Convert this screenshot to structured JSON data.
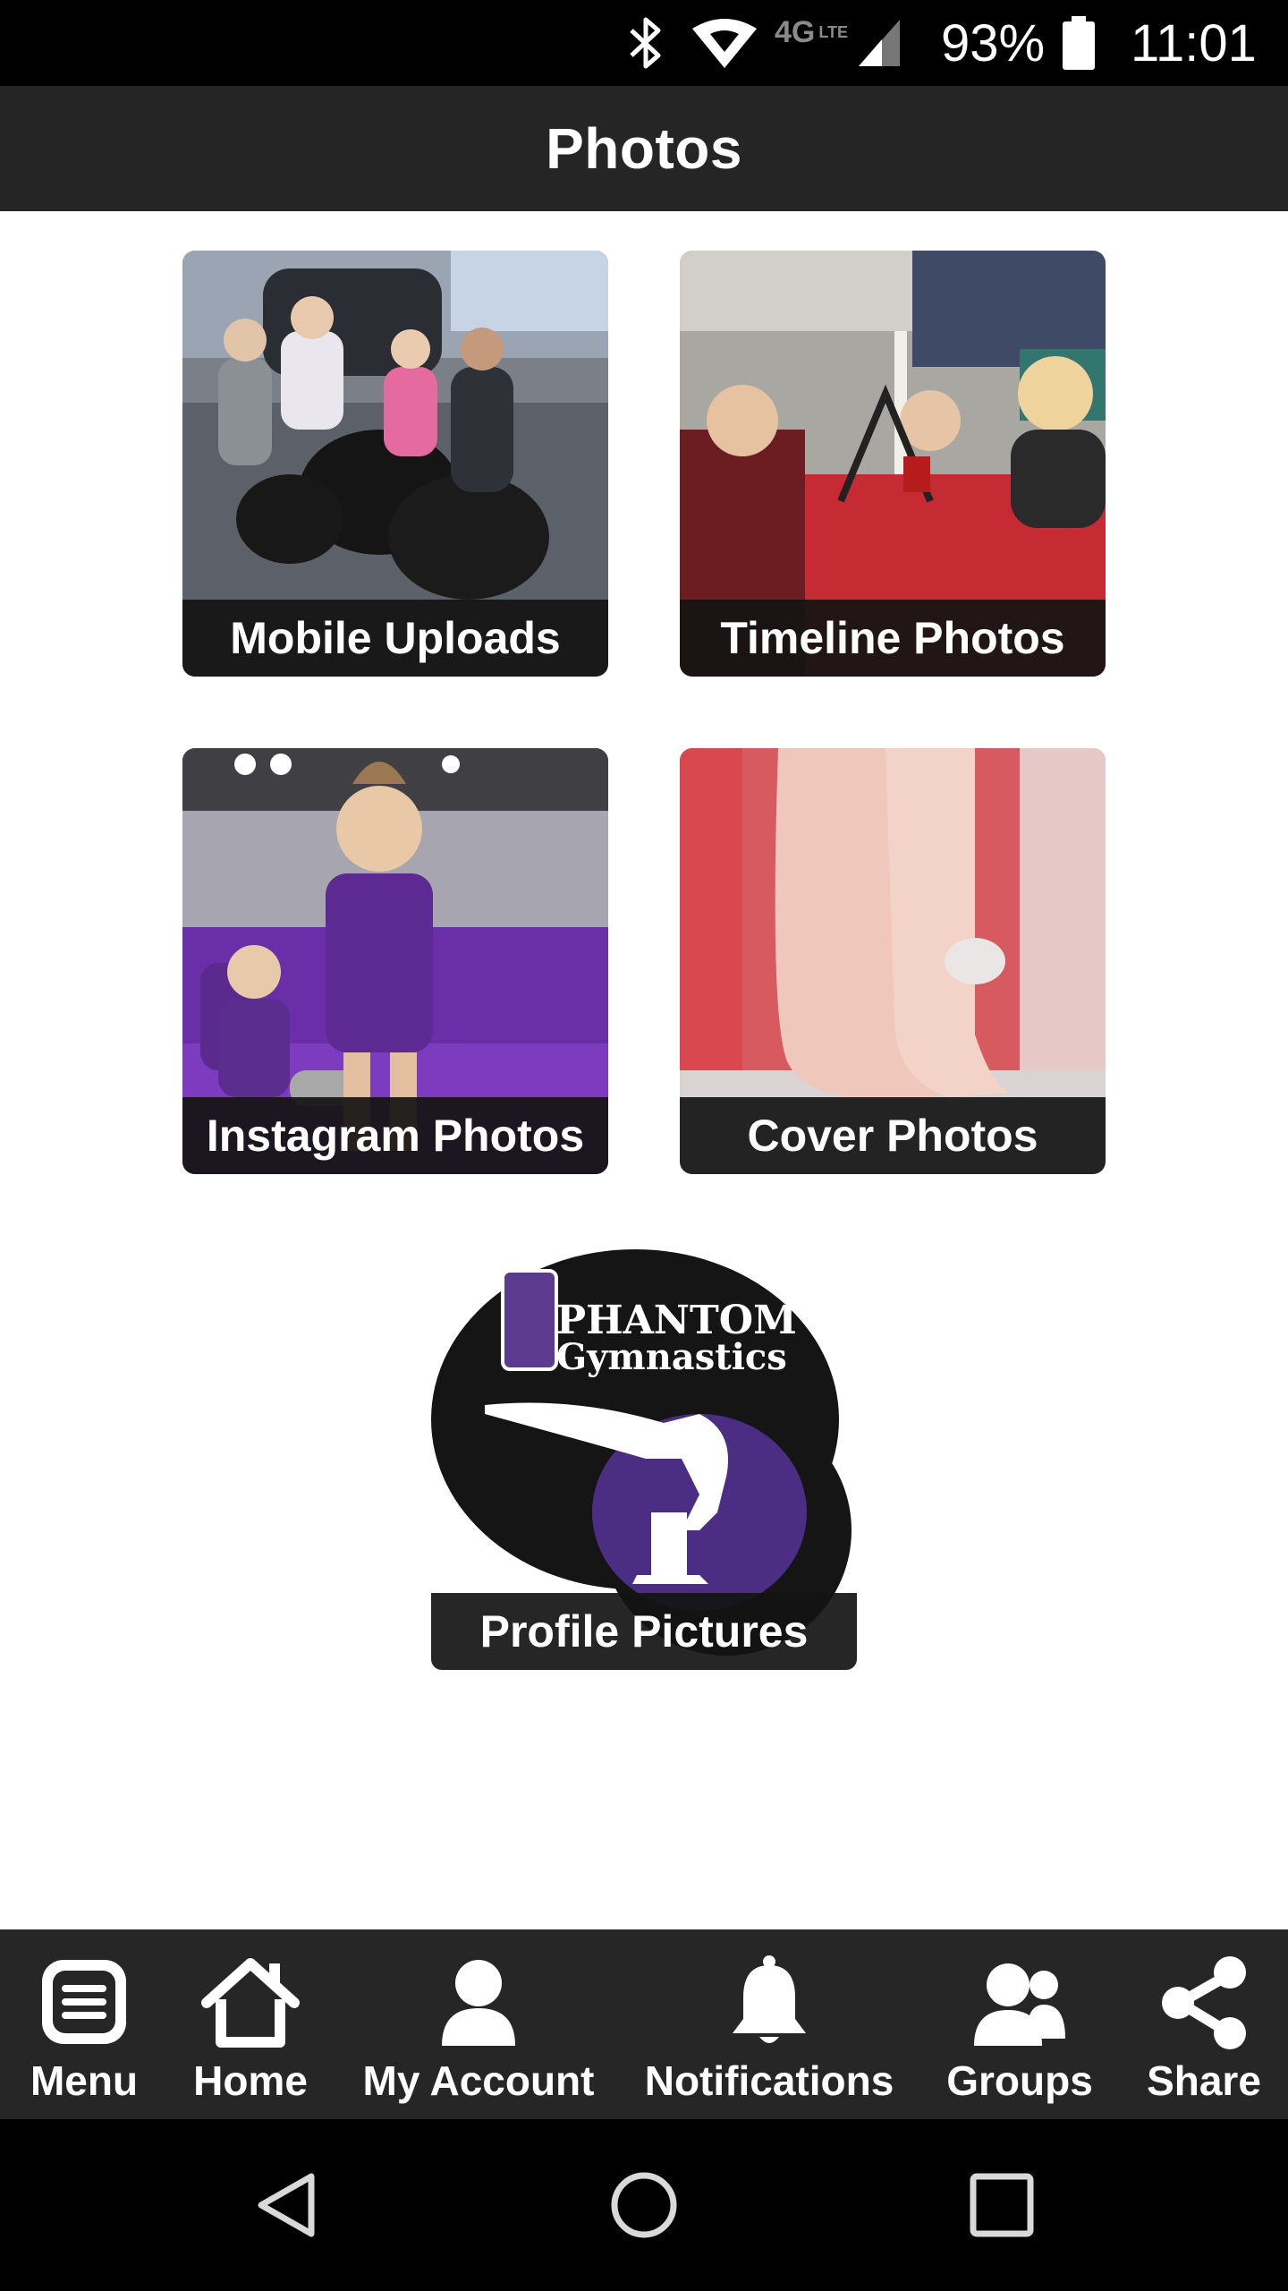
{
  "status_bar": {
    "network": "4G",
    "network_sub": "LTE",
    "battery_percent": "93%",
    "time": "11:01",
    "icons": [
      "bluetooth-icon",
      "wifi-icon",
      "signal-icon",
      "battery-icon"
    ]
  },
  "header": {
    "title": "Photos"
  },
  "albums": [
    {
      "label": "Mobile Uploads"
    },
    {
      "label": "Timeline Photos"
    },
    {
      "label": "Instagram Photos"
    },
    {
      "label": "Cover Photos"
    },
    {
      "label": "Profile Pictures"
    }
  ],
  "logo": {
    "line1": "PHANTOM",
    "line2": "Gymnastics"
  },
  "bottom_nav": {
    "items": [
      {
        "label": "Menu",
        "icon": "menu-icon"
      },
      {
        "label": "Home",
        "icon": "home-icon"
      },
      {
        "label": "My Account",
        "icon": "user-icon"
      },
      {
        "label": "Notifications",
        "icon": "bell-icon"
      },
      {
        "label": "Groups",
        "icon": "groups-icon"
      },
      {
        "label": "Share",
        "icon": "share-icon"
      }
    ]
  },
  "system_nav": {
    "icons": [
      "back-icon",
      "home-circle-icon",
      "recents-icon"
    ]
  },
  "colors": {
    "status_bar": "#000000",
    "app_bar": "#252525",
    "bottom_nav": "#262626",
    "caption_bg": "#141414",
    "text": "#ffffff",
    "brand_purple": "#4b2e83"
  }
}
